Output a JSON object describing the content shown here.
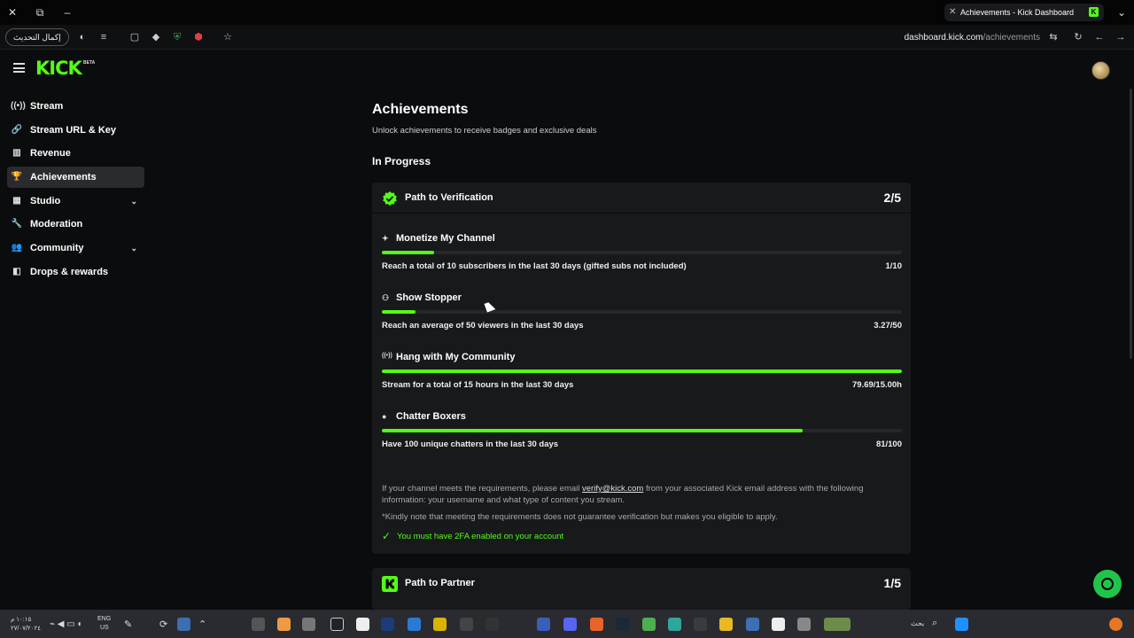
{
  "browser": {
    "tab_title": "Achievements - Kick Dashboard",
    "tab_close": "✕",
    "new_tab": "+",
    "update_pill": "إكمال التحديث",
    "url_host": "dashboard.kick.com",
    "url_path": "/achievements"
  },
  "header": {
    "logo": "KICK",
    "beta": "BETA"
  },
  "sidebar": {
    "items": [
      {
        "label": "Stream",
        "icon": "broadcast-icon",
        "glyph": "((•))"
      },
      {
        "label": "Stream URL & Key",
        "icon": "link-icon",
        "glyph": "🔗"
      },
      {
        "label": "Revenue",
        "icon": "chart-icon",
        "glyph": "▥"
      },
      {
        "label": "Achievements",
        "icon": "trophy-icon",
        "glyph": "🏆"
      },
      {
        "label": "Studio",
        "icon": "grid-icon",
        "glyph": "▦"
      },
      {
        "label": "Moderation",
        "icon": "wrench-icon",
        "glyph": "🔧"
      },
      {
        "label": "Community",
        "icon": "users-icon",
        "glyph": "👥"
      },
      {
        "label": "Drops & rewards",
        "icon": "drops-icon",
        "glyph": "◧"
      }
    ],
    "chevron": "⌄"
  },
  "page": {
    "title": "Achievements",
    "subtitle": "Unlock achievements to receive badges and exclusive deals",
    "section": "In Progress"
  },
  "verification": {
    "title": "Path to Verification",
    "count": "2/5",
    "achievements": [
      {
        "name": "Monetize My Channel",
        "glyph": "✦",
        "desc": "Reach a total of 10 subscribers in the last 30 days (gifted subs not included)",
        "value": "1/10",
        "progress": 0.1
      },
      {
        "name": "Show Stopper",
        "glyph": "⚇",
        "desc": "Reach an average of 50 viewers in the last 30 days",
        "value": "3.27/50",
        "progress": 0.065
      },
      {
        "name": "Hang with My Community",
        "glyph": "((•))",
        "desc": "Stream for a total of 15 hours in the last 30 days",
        "value": "79.69/15.00h",
        "progress": 1.0
      },
      {
        "name": "Chatter Boxers",
        "glyph": "●",
        "desc": "Have 100 unique chatters in the last 30 days",
        "value": "81/100",
        "progress": 0.81
      }
    ],
    "info_prefix": "If your channel meets the requirements, please email ",
    "info_email": "verify@kick.com",
    "info_suffix": " from your associated Kick email address with the following information: your username and what type of content you stream.",
    "note": "*Kindly note that meeting the requirements does not guarantee verification but makes you eligible to apply.",
    "twofa": "You must have 2FA enabled on your account"
  },
  "partner": {
    "title": "Path to Partner",
    "count": "1/5"
  },
  "taskbar": {
    "time": "١٠:١٥ م",
    "date": "٢٧/٠٧/٢٠٢٤",
    "lang_top": "ENG",
    "lang_bottom": "US",
    "search": "بحث"
  }
}
